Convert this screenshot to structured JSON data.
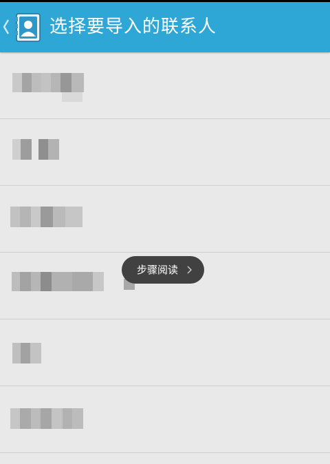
{
  "header": {
    "title": "选择要导入的联系人",
    "icon": "contacts-icon",
    "back_icon": "back-chevron-icon",
    "background_color": "#2fa7d6"
  },
  "contacts": [
    {
      "name_state": "pixelated",
      "blocks": 7
    },
    {
      "name_state": "pixelated",
      "blocks": 4
    },
    {
      "name_state": "pixelated",
      "blocks": 6
    },
    {
      "name_state": "pixelated",
      "blocks": 8
    },
    {
      "name_state": "pixelated",
      "blocks": 2
    },
    {
      "name_state": "pixelated",
      "blocks": 7
    }
  ],
  "tooltip": {
    "label": "步骤阅读",
    "icon": "chevron-right-icon"
  }
}
